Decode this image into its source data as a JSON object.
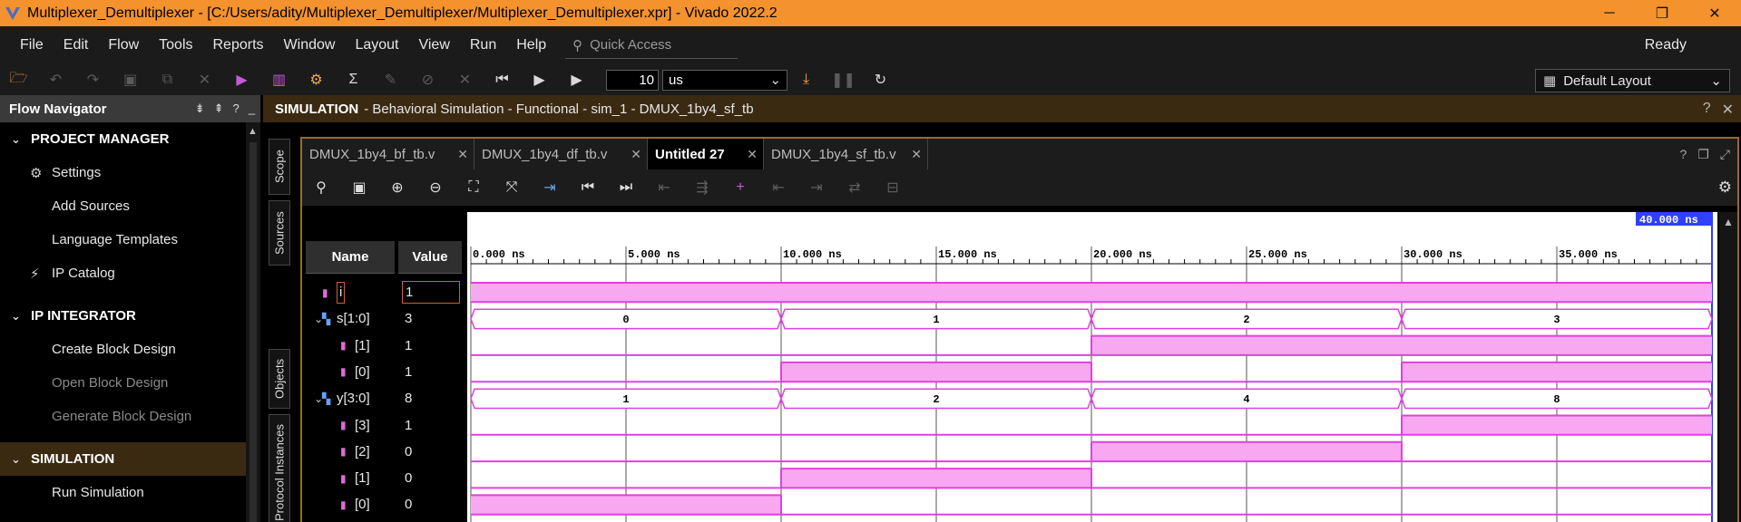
{
  "window": {
    "title": "Multiplexer_Demultiplexer - [C:/Users/adity/Multiplexer_Demultiplexer/Multiplexer_Demultiplexer.xpr] - Vivado 2022.2",
    "minimize": "─",
    "restore": "❐",
    "close": "✕"
  },
  "menu": {
    "items": [
      "File",
      "Edit",
      "Flow",
      "Tools",
      "Reports",
      "Window",
      "Layout",
      "View",
      "Run",
      "Help"
    ],
    "quick_access_placeholder": "Quick Access",
    "status": "Ready"
  },
  "toolbar": {
    "run_time_value": "10",
    "run_time_unit": "us",
    "layout_select": "Default Layout"
  },
  "flow_navigator": {
    "title": "Flow Navigator",
    "sections": [
      {
        "label": "PROJECT MANAGER",
        "items": [
          {
            "label": "Settings",
            "icon": "gear-icon",
            "enabled": true
          },
          {
            "label": "Add Sources",
            "enabled": true
          },
          {
            "label": "Language Templates",
            "enabled": true
          },
          {
            "label": "IP Catalog",
            "icon": "ip-catalog-icon",
            "enabled": true
          }
        ]
      },
      {
        "label": "IP INTEGRATOR",
        "items": [
          {
            "label": "Create Block Design",
            "enabled": true
          },
          {
            "label": "Open Block Design",
            "enabled": false
          },
          {
            "label": "Generate Block Design",
            "enabled": false
          }
        ]
      },
      {
        "label": "SIMULATION",
        "items": [
          {
            "label": "Run Simulation",
            "enabled": true
          }
        ]
      }
    ]
  },
  "simulation_header": {
    "label": "SIMULATION",
    "detail": "- Behavioral Simulation - Functional - sim_1 - DMUX_1by4_sf_tb"
  },
  "side_tabs": [
    "Scope",
    "Sources",
    "Objects",
    "Protocol Instances"
  ],
  "editor_tabs": [
    {
      "label": "DMUX_1by4_bf_tb.v",
      "active": false
    },
    {
      "label": "DMUX_1by4_df_tb.v",
      "active": false
    },
    {
      "label": "Untitled 27",
      "active": true
    },
    {
      "label": "DMUX_1by4_sf_tb.v",
      "active": false
    }
  ],
  "wave": {
    "name_header": "Name",
    "value_header": "Value",
    "cursor_label": "40.000 ns",
    "time_labels": [
      "0.000 ns",
      "5.000 ns",
      "10.000 ns",
      "15.000 ns",
      "20.000 ns",
      "25.000 ns",
      "30.000 ns",
      "35.000 ns"
    ],
    "signals": [
      {
        "name": "i",
        "value": "1",
        "kind": "bit",
        "indent": 0,
        "levels": [
          1,
          1,
          1,
          1
        ]
      },
      {
        "name": "s[1:0]",
        "value": "3",
        "kind": "bus",
        "indent": 0,
        "bus_values": [
          "0",
          "1",
          "2",
          "3"
        ]
      },
      {
        "name": "[1]",
        "value": "1",
        "kind": "bit",
        "indent": 1,
        "levels": [
          0,
          0,
          1,
          1
        ]
      },
      {
        "name": "[0]",
        "value": "1",
        "kind": "bit",
        "indent": 1,
        "levels": [
          0,
          1,
          0,
          1
        ]
      },
      {
        "name": "y[3:0]",
        "value": "8",
        "kind": "bus",
        "indent": 0,
        "bus_values": [
          "1",
          "2",
          "4",
          "8"
        ]
      },
      {
        "name": "[3]",
        "value": "1",
        "kind": "bit",
        "indent": 1,
        "levels": [
          0,
          0,
          0,
          1
        ]
      },
      {
        "name": "[2]",
        "value": "0",
        "kind": "bit",
        "indent": 1,
        "levels": [
          0,
          0,
          1,
          0
        ]
      },
      {
        "name": "[1]",
        "value": "0",
        "kind": "bit",
        "indent": 1,
        "levels": [
          0,
          1,
          0,
          0
        ]
      },
      {
        "name": "[0]",
        "value": "0",
        "kind": "bit",
        "indent": 1,
        "levels": [
          1,
          0,
          0,
          0
        ]
      }
    ],
    "colors": {
      "wave_line": "#e040e0",
      "wave_fill": "#f7a8f0",
      "grid": "#555555",
      "cursor": "#3040ff"
    }
  }
}
